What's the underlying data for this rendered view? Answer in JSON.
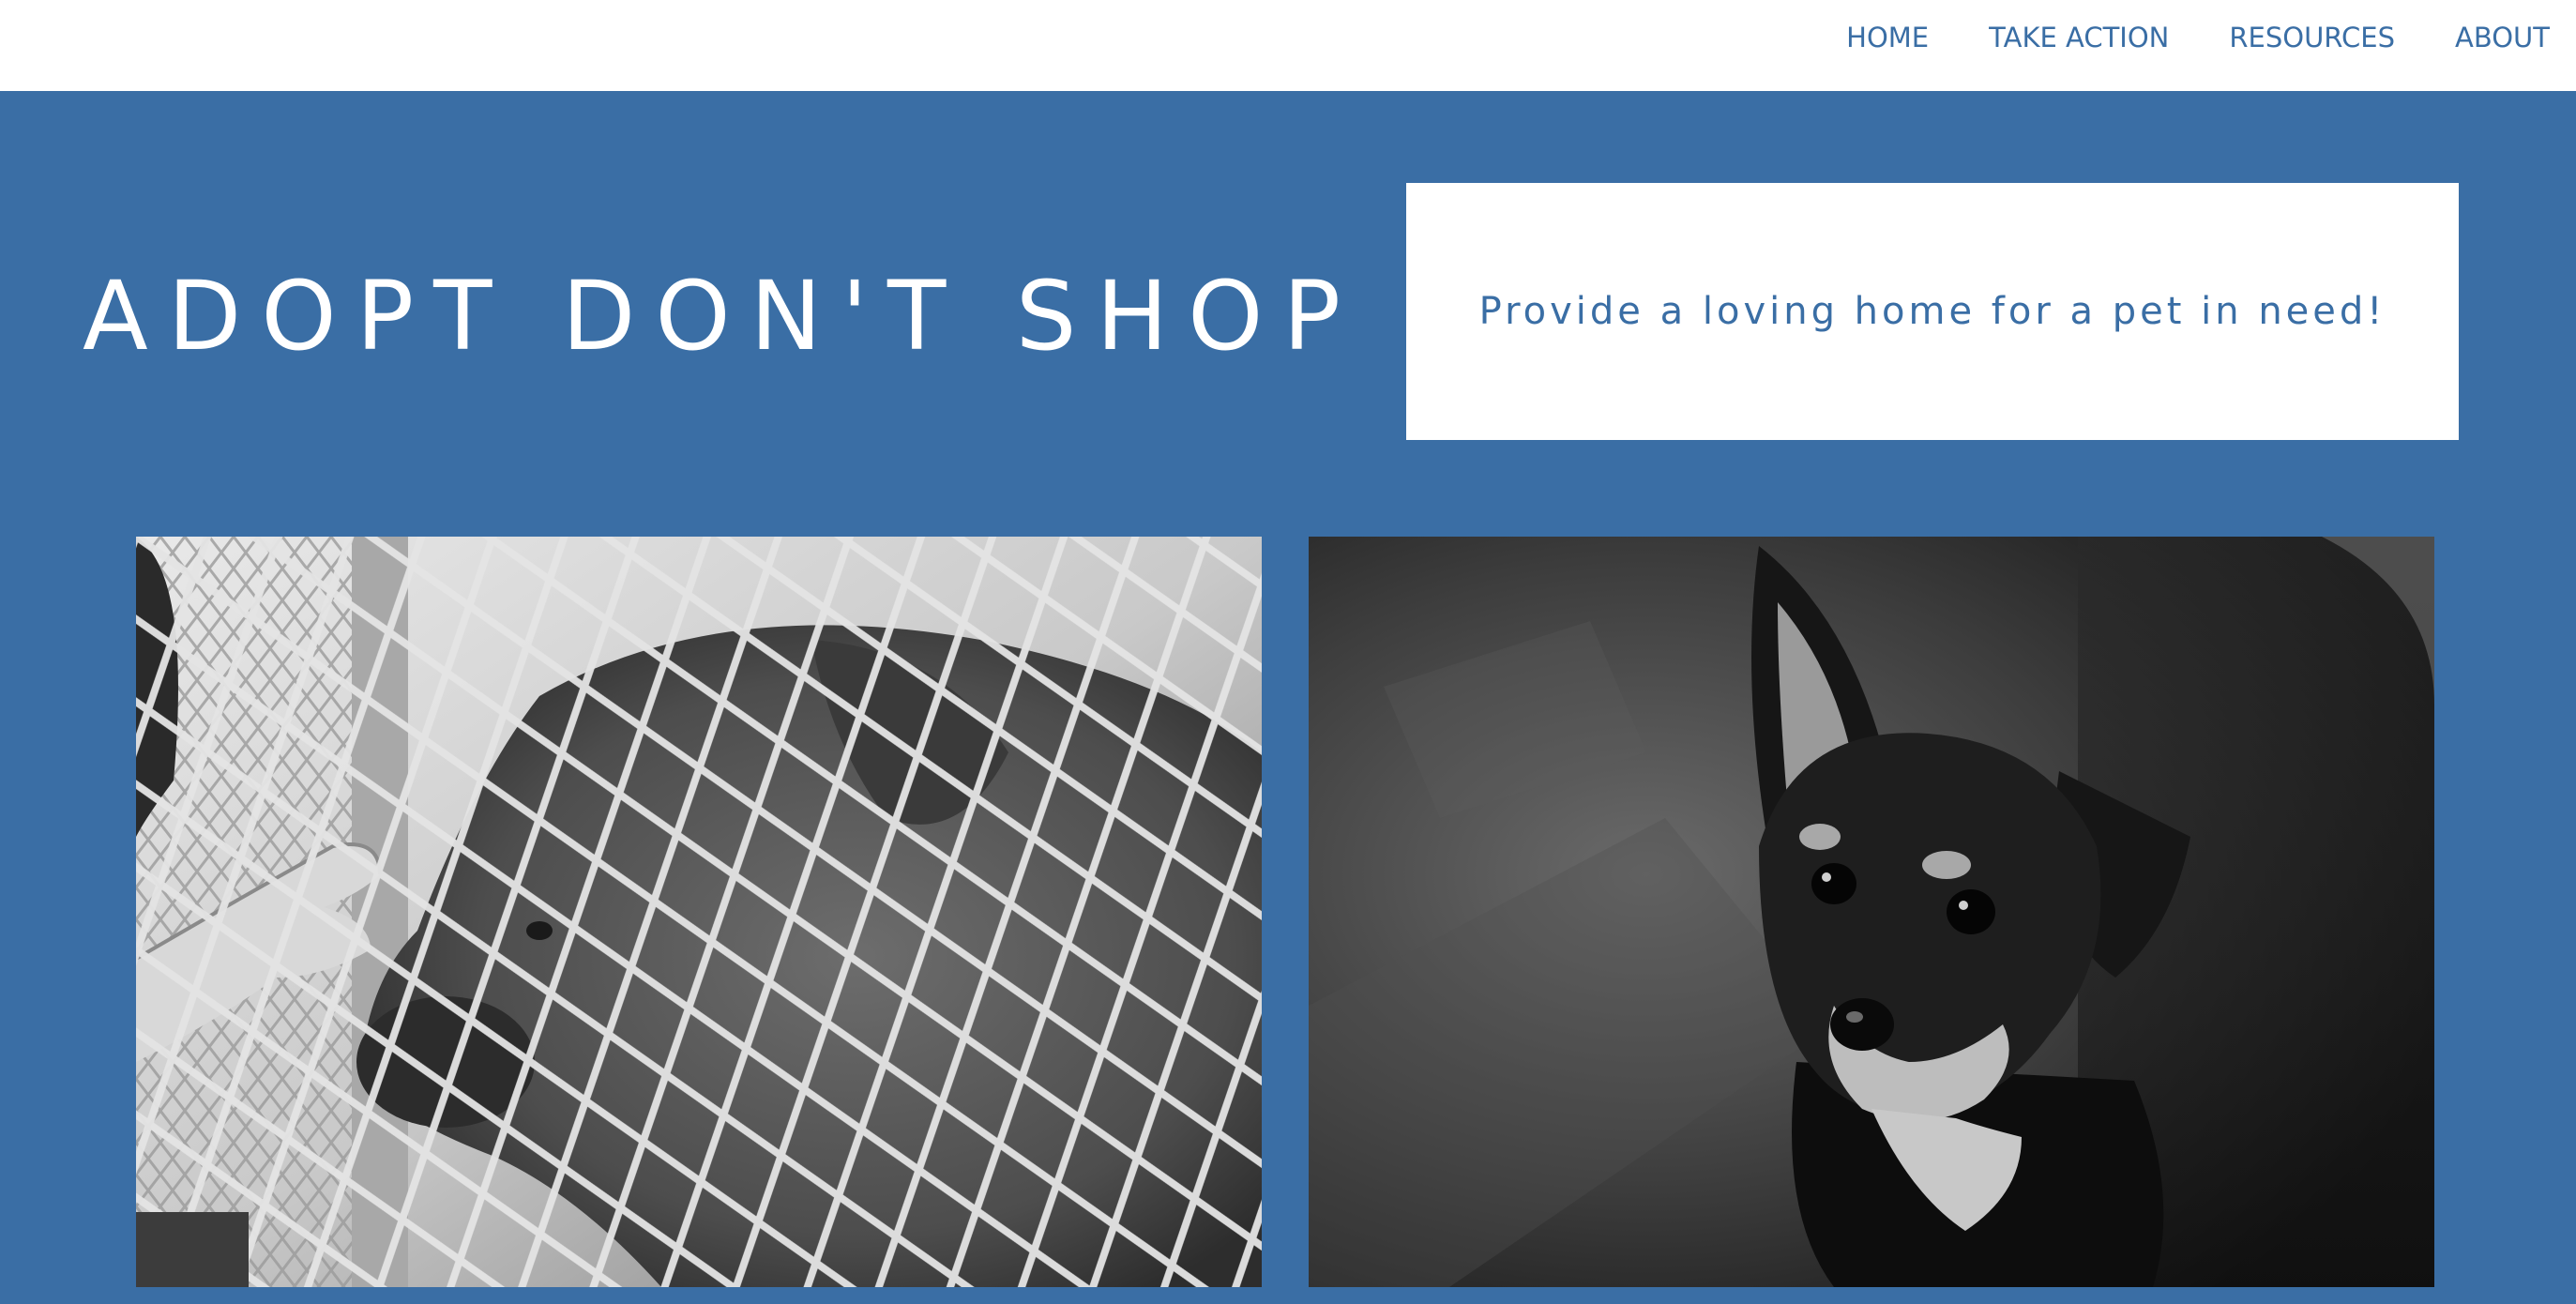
{
  "nav": {
    "items": [
      {
        "label": "HOME"
      },
      {
        "label": "TAKE ACTION"
      },
      {
        "label": "RESOURCES"
      },
      {
        "label": "ABOUT"
      }
    ]
  },
  "hero": {
    "title": "ADOPT DON'T SHOP",
    "tagline": "Provide a loving home for a pet in need!"
  },
  "gallery": {
    "images": [
      {
        "icon": "photo-dog-behind-fence"
      },
      {
        "icon": "photo-small-dog-looking-up"
      }
    ]
  },
  "colors": {
    "brand_blue": "#3a6ea5",
    "white": "#ffffff"
  }
}
